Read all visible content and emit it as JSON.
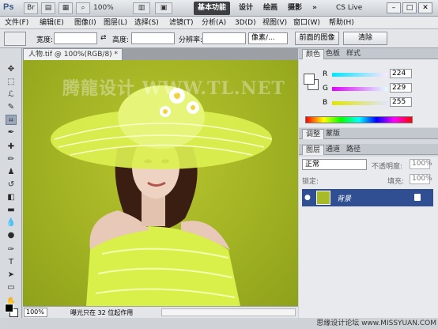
{
  "app": {
    "logo": "Ps",
    "zoom": "100%",
    "workspaces": [
      "基本功能",
      "设计",
      "绘画",
      "摄影",
      "»"
    ],
    "cs_live": "CS Live"
  },
  "menu": [
    "文件(F)",
    "编辑(E)",
    "图像(I)",
    "图层(L)",
    "选择(S)",
    "滤镜(T)",
    "分析(A)",
    "3D(D)",
    "视图(V)",
    "窗口(W)",
    "帮助(H)"
  ],
  "options": {
    "width_label": "宽度:",
    "height_label": "高度:",
    "resolution_label": "分辨率:",
    "unit": "像素/...",
    "front_image": "前面的图像",
    "clear": "清除"
  },
  "document": {
    "tab": "人物.tif @ 100%(RGB/8) *",
    "watermark": "腾龍设计 WWW.TL.NET",
    "status_zoom": "100%",
    "status_msg": "曝光只在 32 位起作用"
  },
  "color_panel": {
    "tabs": [
      "颜色",
      "色板",
      "样式"
    ],
    "channels": [
      {
        "label": "R",
        "value": "224",
        "level": 0.88
      },
      {
        "label": "G",
        "value": "229",
        "level": 0.9
      },
      {
        "label": "B",
        "value": "255",
        "level": 1.0
      }
    ]
  },
  "adjust_tabs": [
    "调整",
    "蒙版"
  ],
  "layers_panel": {
    "tabs": [
      "图层",
      "通道",
      "路径"
    ],
    "blend_mode": "正常",
    "opacity_label": "不透明度:",
    "opacity": "100%",
    "lock_label": "锁定:",
    "fill_label": "填充:",
    "fill": "100%",
    "layer_name": "背景"
  },
  "site_mark": "思缘设计论坛 www.MISSYUAN.COM",
  "colors": {
    "canvas": "#a8b826",
    "selected_layer": "#2f4f92"
  }
}
